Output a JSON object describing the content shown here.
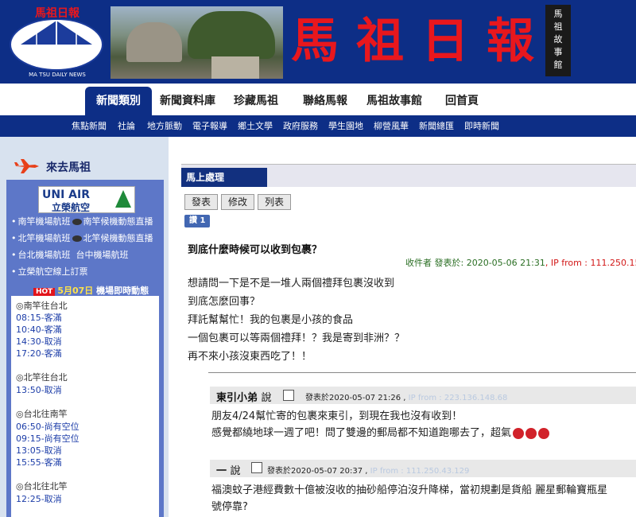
{
  "banner": {
    "logo_text": "馬祖日報",
    "logo_subtitle": "MA TSU DAILY NEWS",
    "masthead": [
      "馬",
      "祖",
      "日",
      "報"
    ],
    "museum": [
      "馬",
      "祖",
      "故",
      "事",
      "館"
    ]
  },
  "main_nav": [
    {
      "label": "新聞類別",
      "active": true
    },
    {
      "label": "新聞資料庫"
    },
    {
      "label": "珍藏馬祖"
    },
    {
      "label": "聯絡馬報"
    },
    {
      "label": "馬祖故事館"
    },
    {
      "label": "回首頁"
    }
  ],
  "sub_nav": [
    "焦點新聞",
    "社論",
    "地方脈動",
    "電子報導",
    "鄉土文學",
    "政府服務",
    "學生園地",
    "柳營風華",
    "新聞總匯",
    "即時新聞"
  ],
  "sidebar": {
    "title": "來去馬祖",
    "airline_en": "UNI AIR",
    "airline_zh": "立榮航空",
    "flights": [
      {
        "a": "南竿機場航班",
        "b": "南竿候機動態直播"
      },
      {
        "a": "北竿機場航班",
        "b": "北竿候機動態直播"
      },
      {
        "a": "台北機場航班",
        "b": "台中機場航班"
      },
      {
        "a": "立榮航空線上訂票",
        "b": ""
      }
    ],
    "hot_badge": "HOT",
    "hot_date": "5月07日",
    "hot_label": "機場即時動態",
    "schedule": [
      {
        "type": "h",
        "text": "◎南竿往台北"
      },
      {
        "type": "r",
        "text": "08:15-客滿"
      },
      {
        "type": "r",
        "text": "10:40-客滿"
      },
      {
        "type": "r",
        "text": "14:30-取消"
      },
      {
        "type": "r",
        "text": "17:20-客滿"
      },
      {
        "type": "h",
        "text": "◎北竿往台北"
      },
      {
        "type": "r",
        "text": "13:50-取消"
      },
      {
        "type": "h",
        "text": "◎台北往南竿"
      },
      {
        "type": "r",
        "text": "06:50-尚有空位"
      },
      {
        "type": "r",
        "text": "09:15-尚有空位"
      },
      {
        "type": "r",
        "text": "13:05-取消"
      },
      {
        "type": "r",
        "text": "15:55-客滿"
      },
      {
        "type": "h",
        "text": "◎台北往北竿"
      },
      {
        "type": "r",
        "text": "12:25-取消"
      }
    ]
  },
  "content": {
    "category": "馬上處理",
    "buttons": [
      "發表",
      "修改",
      "列表"
    ],
    "fb_label": "讚 1",
    "title": "到底什麼時候可以收到包裹？",
    "meta_author": "收件者 發表於",
    "meta_time": ": 2020-05-06 21:31",
    "meta_ip": ", IP from : 111.250.153",
    "body": [
      "想請問一下是不是一堆人兩個禮拜包裹沒收到",
      "到底怎麼回事？",
      "拜託幫幫忙！我的包裹是小孩的食品",
      "一個包裹可以等兩個禮拜！？我是寄到非洲？？",
      "再不來小孩沒東西吃了！！"
    ]
  },
  "replies": [
    {
      "name": "東引小弟",
      "say": "說",
      "meta": "發表於2020-05-07 21:26 ,",
      "ip": "IP from : 223.136.148.68",
      "lines": [
        "朋友4/24幫忙寄的包裹來東引，到現在我也沒有收到！",
        "感覺都繞地球一週了吧！問了雙邊的郵局都不知道跑哪去了，超氣"
      ]
    },
    {
      "name": "一",
      "say": "說",
      "meta": "發表於2020-05-07 20:37 ,",
      "ip": "IP from : 111.250.43.129",
      "lines": [
        "福澳蚊子港經費數十億被沒收的抽砂船停泊沒升降梯，當初規劃是貨船 麗星郵輪寶瓶星",
        "號停靠?"
      ]
    }
  ],
  "colors": {
    "brand_blue": "#0d2e86",
    "masthead_red": "#e8171d",
    "side_bg": "#d8e2ef",
    "panel_blue": "#5d77c8"
  }
}
